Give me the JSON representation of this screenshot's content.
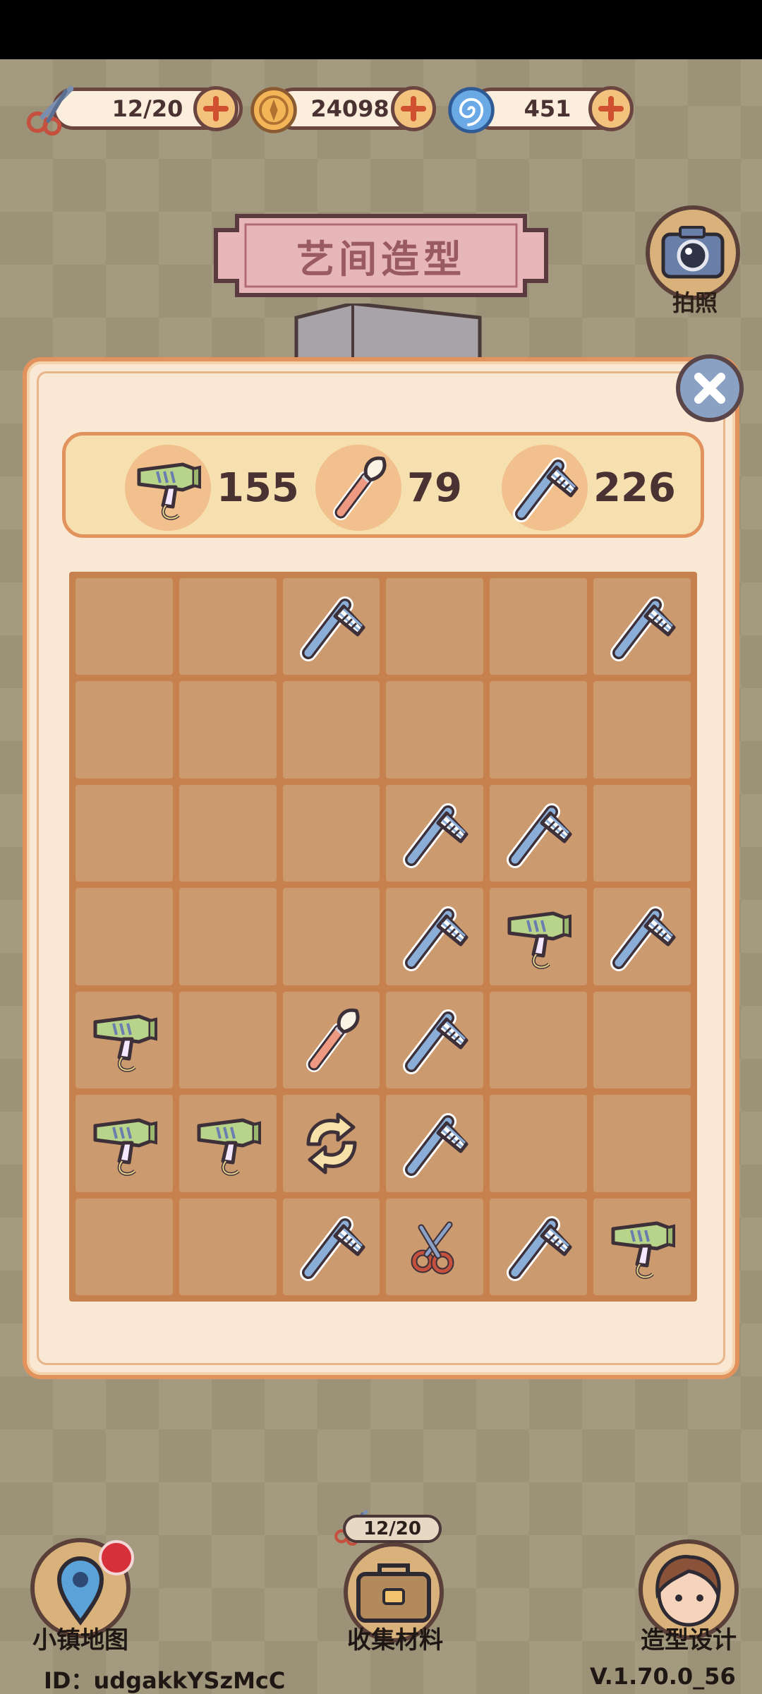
{
  "resources": {
    "energy": "12/20",
    "coins": "24098",
    "gems": "451"
  },
  "title": "艺间造型",
  "camera_label": "拍照",
  "counts": {
    "hairdryer": "155",
    "brush": "79",
    "comb": "226"
  },
  "grid": [
    [
      "",
      "",
      "comb",
      "",
      "",
      "comb"
    ],
    [
      "",
      "",
      "",
      "",
      "",
      ""
    ],
    [
      "",
      "",
      "",
      "comb",
      "comb",
      ""
    ],
    [
      "",
      "",
      "",
      "comb",
      "hairdryer",
      "comb"
    ],
    [
      "hairdryer",
      "",
      "brush",
      "comb",
      "",
      ""
    ],
    [
      "hairdryer",
      "hairdryer",
      "refresh",
      "comb",
      "",
      ""
    ],
    [
      "",
      "",
      "comb",
      "scissors",
      "comb",
      "hairdryer"
    ]
  ],
  "bottom_nav": {
    "map": "小镇地图",
    "collect": "收集材料",
    "design": "造型设计",
    "collect_counter": "12/20"
  },
  "footer": {
    "id": "ID：udgakkYSzMcC",
    "version": "V.1.70.0_56"
  },
  "colors": {
    "panel_bg": "#f8e8d4",
    "panel_border": "#e2925c",
    "cell": "#cc9a6f",
    "grid_bg": "#c7814f"
  }
}
